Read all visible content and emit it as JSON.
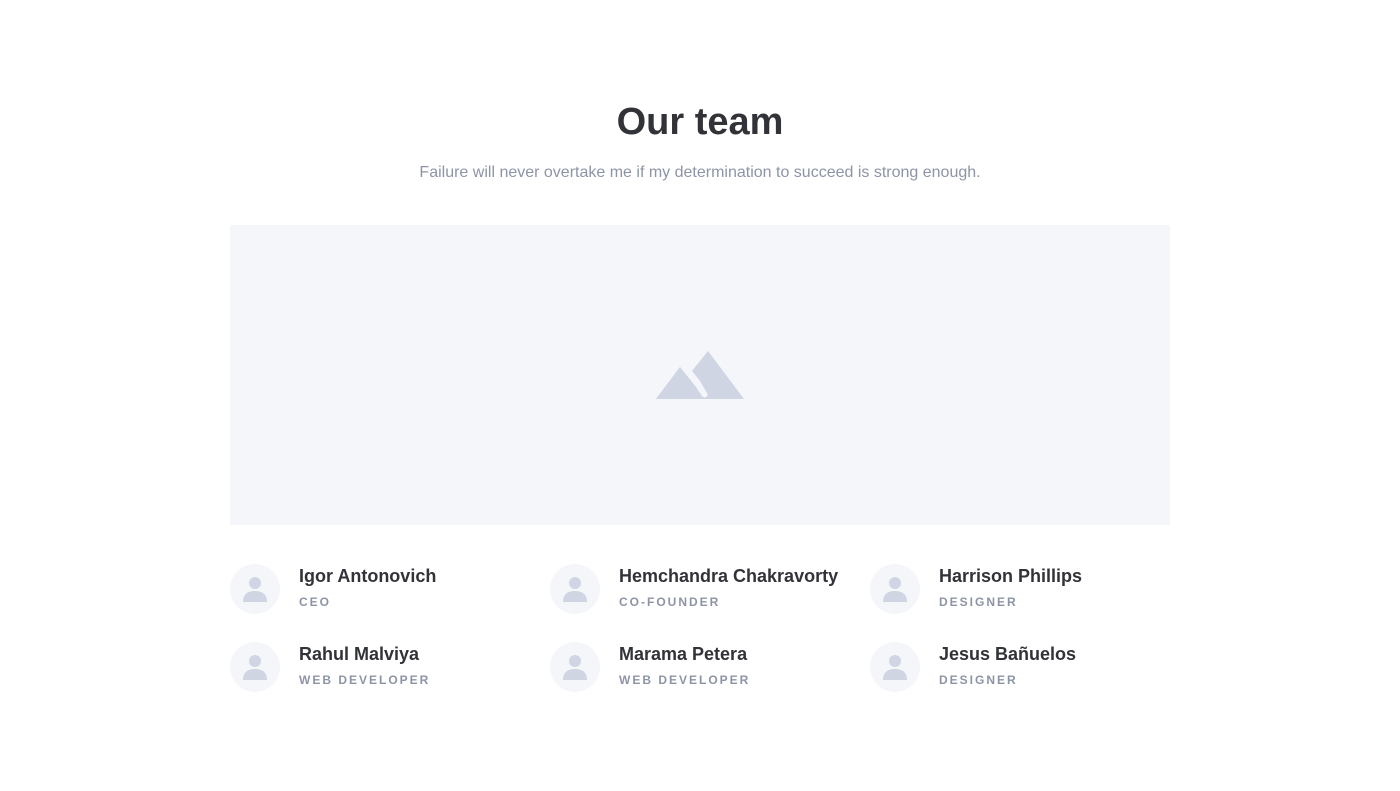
{
  "section": {
    "title": "Our team",
    "subtitle": "Failure will never overtake me if my determination to succeed is strong enough."
  },
  "hero_image": {
    "icon": "mountain-image-placeholder-icon",
    "background": "#f4f6fa",
    "icon_color": "#cfd5e2"
  },
  "team": [
    {
      "name": "Igor Antonovich",
      "role": "CEO",
      "avatar_icon": "user-icon"
    },
    {
      "name": "Hemchandra Chakravorty",
      "role": "CO-FOUNDER",
      "avatar_icon": "user-icon"
    },
    {
      "name": "Harrison Phillips",
      "role": "DESIGNER",
      "avatar_icon": "user-icon"
    },
    {
      "name": "Rahul Malviya",
      "role": "WEB DEVELOPER",
      "avatar_icon": "user-icon"
    },
    {
      "name": "Marama Petera",
      "role": "WEB DEVELOPER",
      "avatar_icon": "user-icon"
    },
    {
      "name": "Jesus Bañuelos",
      "role": "DESIGNER",
      "avatar_icon": "user-icon"
    }
  ],
  "colors": {
    "heading": "#323338",
    "muted": "#8d94a6",
    "surface": "#f4f6fa",
    "placeholder_icon": "#cfd5e2"
  }
}
